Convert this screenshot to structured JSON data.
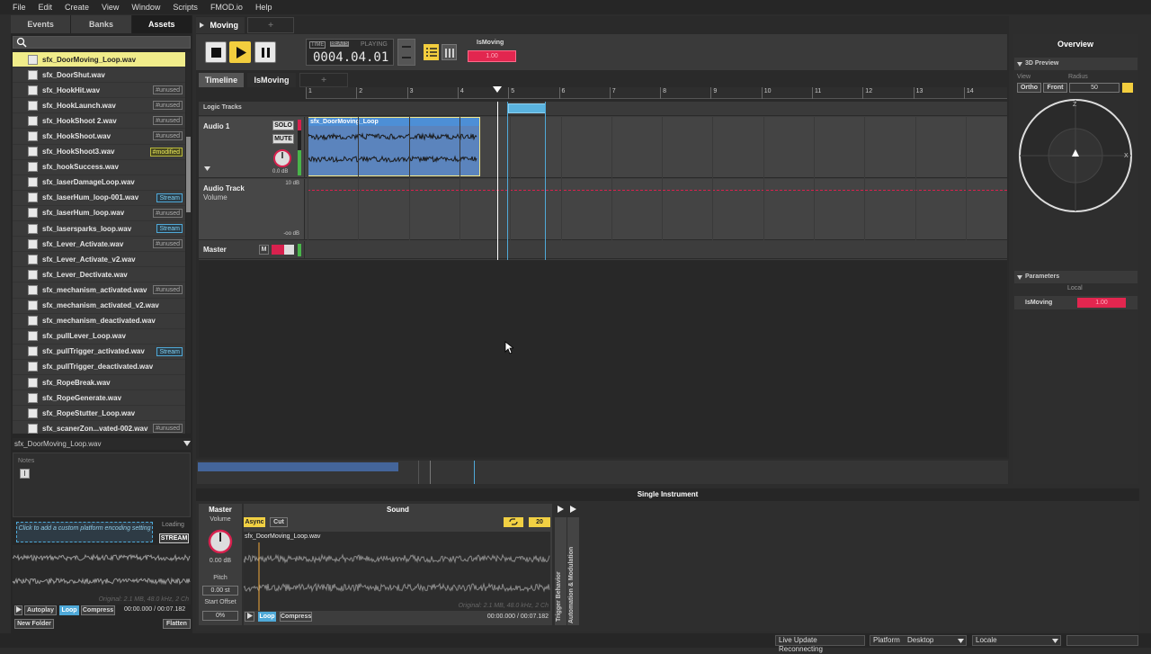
{
  "menu": [
    "File",
    "Edit",
    "Create",
    "View",
    "Window",
    "Scripts",
    "FMOD.io",
    "Help"
  ],
  "left_tabs": [
    "Events",
    "Banks",
    "Assets"
  ],
  "assets": [
    {
      "name": "sfx_DoorMoving_Loop.wav",
      "badge": "",
      "selected": true
    },
    {
      "name": "sfx_DoorShut.wav",
      "badge": ""
    },
    {
      "name": "sfx_HookHit.wav",
      "badge": "#unused"
    },
    {
      "name": "sfx_HookLaunch.wav",
      "badge": "#unused"
    },
    {
      "name": "sfx_HookShoot 2.wav",
      "badge": "#unused"
    },
    {
      "name": "sfx_HookShoot.wav",
      "badge": "#unused"
    },
    {
      "name": "sfx_HookShoot3.wav",
      "badge": "#modified"
    },
    {
      "name": "sfx_hookSuccess.wav",
      "badge": ""
    },
    {
      "name": "sfx_laserDamageLoop.wav",
      "badge": ""
    },
    {
      "name": "sfx_laserHum_loop-001.wav",
      "badge": "Stream"
    },
    {
      "name": "sfx_laserHum_loop.wav",
      "badge": "#unused"
    },
    {
      "name": "sfx_lasersparks_loop.wav",
      "badge": "Stream"
    },
    {
      "name": "sfx_Lever_Activate.wav",
      "badge": "#unused"
    },
    {
      "name": "sfx_Lever_Activate_v2.wav",
      "badge": ""
    },
    {
      "name": "sfx_Lever_Dectivate.wav",
      "badge": ""
    },
    {
      "name": "sfx_mechanism_activated.wav",
      "badge": "#unused"
    },
    {
      "name": "sfx_mechanism_activated_v2.wav",
      "badge": ""
    },
    {
      "name": "sfx_mechanism_deactivated.wav",
      "badge": ""
    },
    {
      "name": "sfx_pullLever_Loop.wav",
      "badge": ""
    },
    {
      "name": "sfx_pullTrigger_activated.wav",
      "badge": "Stream"
    },
    {
      "name": "sfx_pullTrigger_deactivated.wav",
      "badge": ""
    },
    {
      "name": "sfx_RopeBreak.wav",
      "badge": ""
    },
    {
      "name": "sfx_RopeGenerate.wav",
      "badge": ""
    },
    {
      "name": "sfx_RopeStutter_Loop.wav",
      "badge": ""
    },
    {
      "name": "sfx_scanerZon...vated-002.wav",
      "badge": "#unused"
    }
  ],
  "selected_name": "sfx_DoorMoving_Loop.wav",
  "notes_label": "Notes",
  "encode_text": "Click to add a custom platform encoding setting",
  "loading_label": "Loading",
  "stream_button": "STREAM",
  "left_original": "Original: 2.1 MB, 48.0 kHz, 2 Ch",
  "left_buttons": {
    "autoplay": "Autoplay",
    "loop": "Loop",
    "compress": "Compress",
    "time": "00:00.000 / 00:07.182",
    "new_folder": "New Folder",
    "flatten": "Flatten"
  },
  "event_tab": "Moving",
  "new_tab": "+",
  "timer": {
    "time": "TIME",
    "beats": "BEATS",
    "playing": "PLAYING",
    "value": "0004.04.01"
  },
  "param_label": "IsMoving",
  "param_value": "1.00",
  "subtabs": [
    "Timeline",
    "IsMoving",
    "+"
  ],
  "ruler": [
    "1",
    "2",
    "3",
    "4",
    "5",
    "6",
    "7",
    "8",
    "9",
    "10",
    "11",
    "12",
    "13",
    "14"
  ],
  "logic_tracks": "Logic Tracks",
  "audio1": {
    "name": "Audio 1",
    "solo": "SOLO",
    "mute": "MUTE",
    "db": "0.0 dB",
    "region": "sfx_DoorMoving_Loop"
  },
  "auto_track": {
    "name": "Audio Track",
    "sub": "Volume",
    "top": "10 dB",
    "bottom": "-oo dB"
  },
  "master_track": {
    "name": "Master",
    "m": "M"
  },
  "overview": "Overview",
  "preview3d": {
    "title": "3D Preview",
    "view": "View",
    "radius": "Radius",
    "ortho": "Ortho",
    "front": "Front",
    "radius_val": "50",
    "z": "Z",
    "x": "X"
  },
  "parameters": {
    "title": "Parameters",
    "local": "Local",
    "name": "IsMoving",
    "value": "1.00"
  },
  "single_instrument": "Single Instrument",
  "deck": {
    "master": "Master",
    "sound": "Sound",
    "volume": "Volume",
    "vol_db": "0.00 dB",
    "pitch": "Pitch",
    "pitch_val": "0.00 st",
    "start_offset": "Start Offset",
    "offset_val": "0%",
    "async": "Async",
    "cut": "Cut",
    "count": "20",
    "file": "sfx_DoorMoving_Loop.wav",
    "original": "Original: 2.1 MB, 48.0 kHz, 2 Ch",
    "loop": "Loop",
    "compress": "Compress",
    "time": "00:00.000 / 00:07.182",
    "trigger": "Trigger Behavior",
    "automation": "Automation & Modulation"
  },
  "status": {
    "live": "Live Update Reconnecting",
    "platform": "Platform",
    "platform_val": "Desktop",
    "locale": "Locale"
  }
}
